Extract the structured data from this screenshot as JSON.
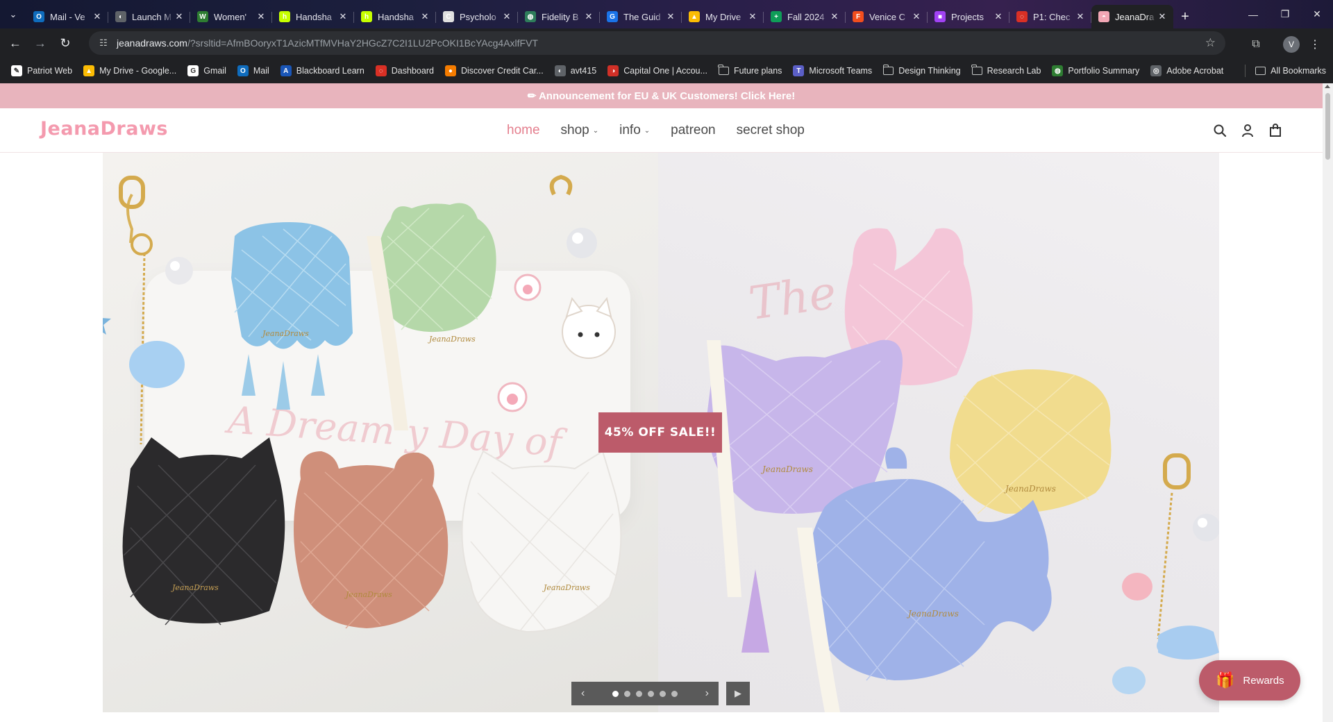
{
  "browser": {
    "tabs": [
      {
        "title": "Mail - Ve",
        "fav_color": "#0f6cbd",
        "fav_glyph": "O"
      },
      {
        "title": "Launch M",
        "fav_color": "#5f6368",
        "fav_glyph": "◐"
      },
      {
        "title": "Women'",
        "fav_color": "#2e7d32",
        "fav_glyph": "W"
      },
      {
        "title": "Handsha",
        "fav_color": "#c6ff00",
        "fav_glyph": "h"
      },
      {
        "title": "Handsha",
        "fav_color": "#c6ff00",
        "fav_glyph": "h"
      },
      {
        "title": "Psycholo",
        "fav_color": "#e0e0e0",
        "fav_glyph": "C"
      },
      {
        "title": "Fidelity B",
        "fav_color": "#2e7d5b",
        "fav_glyph": "◍"
      },
      {
        "title": "The Guid",
        "fav_color": "#1a73e8",
        "fav_glyph": "G"
      },
      {
        "title": "My Drive",
        "fav_color": "#fbbc04",
        "fav_glyph": "▲"
      },
      {
        "title": "Fall 2024",
        "fav_color": "#0f9d58",
        "fav_glyph": "+"
      },
      {
        "title": "Venice C",
        "fav_color": "#f24e1e",
        "fav_glyph": "F"
      },
      {
        "title": "Projects",
        "fav_color": "#a142f4",
        "fav_glyph": "■"
      },
      {
        "title": "P1: Chec",
        "fav_color": "#d93025",
        "fav_glyph": "◌"
      },
      {
        "title": "JeanaDra",
        "fav_color": "#f2a7b5",
        "fav_glyph": "◓",
        "active": true
      }
    ],
    "tab_close_glyph": "✕",
    "new_tab_glyph": "+",
    "window_controls": [
      "—",
      "❐",
      "✕"
    ],
    "nav": {
      "back": "←",
      "forward": "→",
      "reload": "↻"
    },
    "url_host": "jeanadraws.com",
    "url_rest": "/?srsltid=AfmBOoryxT1AzicMTfMVHaY2HGcZ7C2I1LU2PcOKI1BcYAcg4AxlfFVT",
    "profile_initial": "V",
    "bookmarks": [
      {
        "label": "Patriot Web",
        "kind": "icon",
        "color": "#ffffff",
        "glyph": "✎"
      },
      {
        "label": "My Drive - Google...",
        "kind": "icon",
        "color": "#fbbc04",
        "glyph": "▲"
      },
      {
        "label": "Gmail",
        "kind": "icon",
        "color": "#ffffff",
        "glyph": "G"
      },
      {
        "label": "Mail",
        "kind": "icon",
        "color": "#0f6cbd",
        "glyph": "O"
      },
      {
        "label": "Blackboard Learn",
        "kind": "icon",
        "color": "#1a56b8",
        "glyph": "A"
      },
      {
        "label": "Dashboard",
        "kind": "icon",
        "color": "#d93025",
        "glyph": "◌"
      },
      {
        "label": "Discover Credit Car...",
        "kind": "icon",
        "color": "#f57c00",
        "glyph": "●"
      },
      {
        "label": "avt415",
        "kind": "icon",
        "color": "#5f6368",
        "glyph": "◐"
      },
      {
        "label": "Capital One | Accou...",
        "kind": "icon",
        "color": "#d03027",
        "glyph": "◑"
      },
      {
        "label": "Future plans",
        "kind": "folder"
      },
      {
        "label": "Microsoft Teams",
        "kind": "icon",
        "color": "#5b5fc7",
        "glyph": "T"
      },
      {
        "label": "Design Thinking",
        "kind": "folder"
      },
      {
        "label": "Research Lab",
        "kind": "folder"
      },
      {
        "label": "Portfolio Summary",
        "kind": "icon",
        "color": "#2e7d32",
        "glyph": "◍"
      },
      {
        "label": "Adobe Acrobat",
        "kind": "icon",
        "color": "#5f6368",
        "glyph": "◎"
      }
    ],
    "all_bookmarks": "All Bookmarks"
  },
  "site": {
    "announcement": "✏ Announcement for EU & UK Customers! Click Here!",
    "logo": "JeanaDraws",
    "nav": [
      {
        "label": "home",
        "active": true,
        "dropdown": false
      },
      {
        "label": "shop",
        "active": false,
        "dropdown": true
      },
      {
        "label": "info",
        "active": false,
        "dropdown": true
      },
      {
        "label": "patreon",
        "active": false,
        "dropdown": false
      },
      {
        "label": "secret shop",
        "active": false,
        "dropdown": false
      }
    ],
    "caret_glyph": "⌄",
    "hero": {
      "sale_label": "45% OFF SALE!!",
      "script_left": "A Dream y Day of",
      "script_right": "The End",
      "bag_brand": "JeanaDraws",
      "slide_count": 6,
      "active_slide": 1,
      "prev_glyph": "‹",
      "next_glyph": "›",
      "pause_glyph": "▶"
    },
    "rewards_label": "Rewards",
    "colors": {
      "accent": "#bc5b6a",
      "logo": "#f49aae",
      "banner": "#e8b4bd",
      "nav_active": "#e47e8d"
    }
  }
}
